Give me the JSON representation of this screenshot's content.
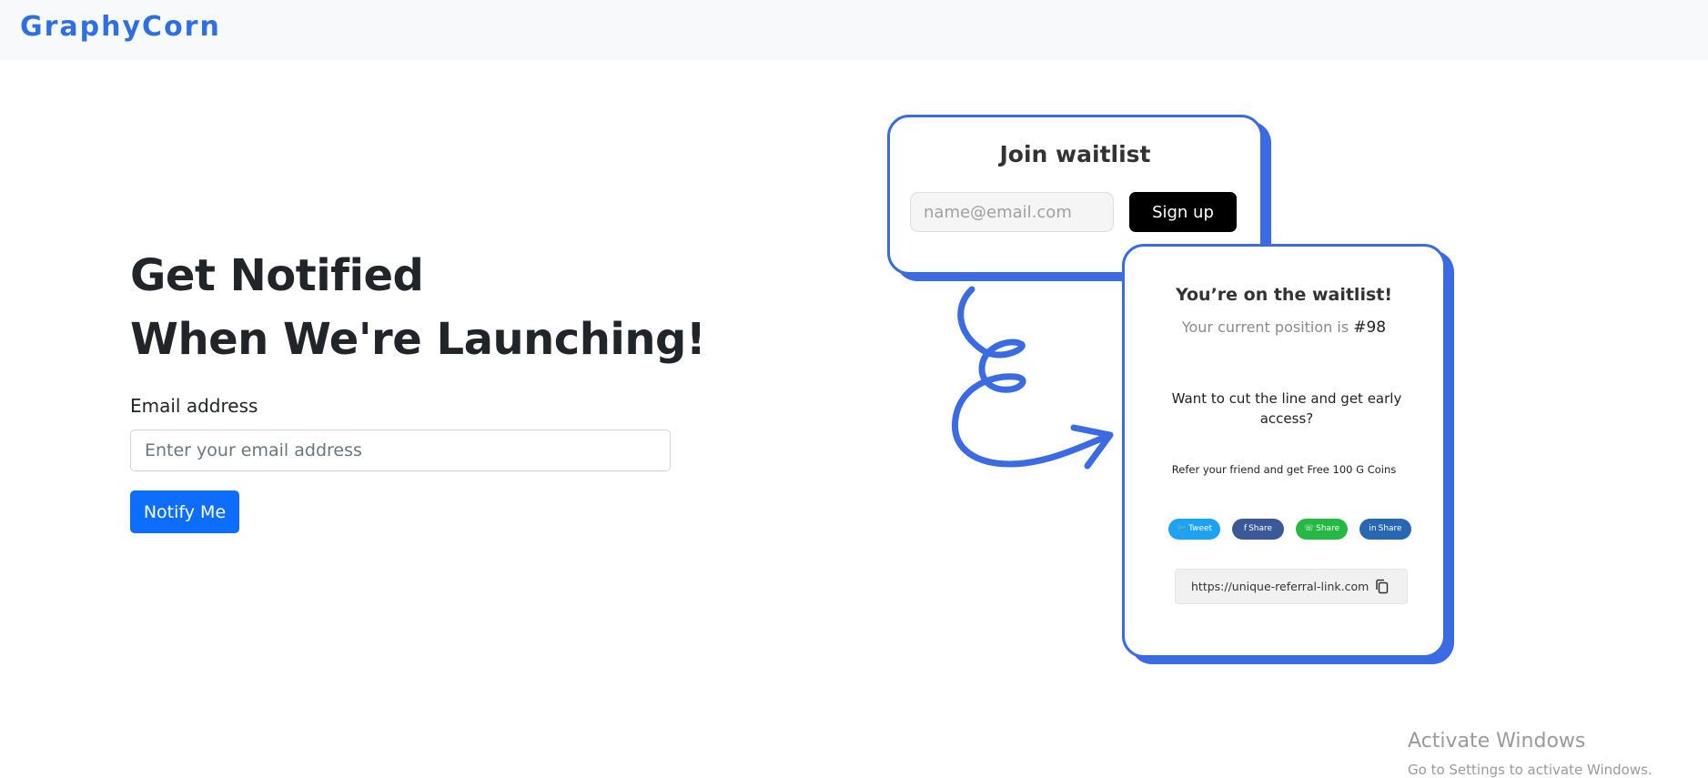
{
  "nav": {
    "logo": "GraphyCorn"
  },
  "hero": {
    "title_line1": "Get Notified",
    "title_line2": "When We're Launching!",
    "email_label": "Email address",
    "email_placeholder": "Enter your email address",
    "notify_label": "Notify Me"
  },
  "join_card": {
    "title": "Join waitlist",
    "email_placeholder": "name@email.com",
    "signup_label": "Sign up"
  },
  "waitlist_card": {
    "title": "You’re on the waitlist!",
    "position_label": "Your current position is",
    "position_value": "#98",
    "cut_line": "Want to cut the line and  get early access?",
    "refer": "Refer your friend and get Free  100 G Coins",
    "share_buttons": [
      {
        "label": "Tweet",
        "color": "#1da1f2",
        "icon": "twitter-icon"
      },
      {
        "label": "Share",
        "color": "#3b5998",
        "icon": "facebook-icon"
      },
      {
        "label": "Share",
        "color": "#25b943",
        "icon": "whatsapp-icon"
      },
      {
        "label": "Share",
        "color": "#2867b2",
        "icon": "linkedin-icon"
      }
    ],
    "referral_link": "https://unique-referral-link.com"
  },
  "watermark": {
    "line1": "Activate Windows",
    "line2": "Go to Settings to activate Windows."
  },
  "colors": {
    "accent": "#3a6be3",
    "primary_button": "#0d6efd",
    "navbar_bg": "#f8f9fa"
  }
}
